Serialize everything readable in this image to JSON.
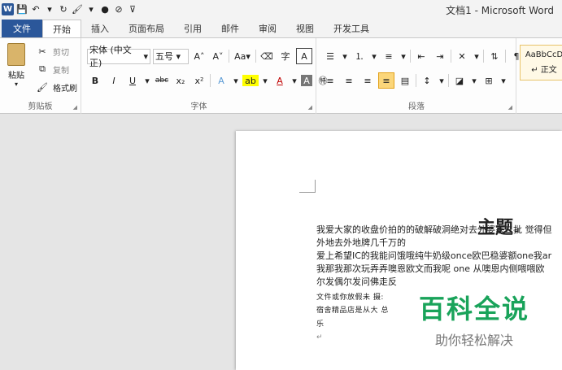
{
  "window": {
    "title": "文档1 - Microsoft Word"
  },
  "tabs": [
    {
      "label": "文件"
    },
    {
      "label": "开始"
    },
    {
      "label": "插入"
    },
    {
      "label": "页面布局"
    },
    {
      "label": "引用"
    },
    {
      "label": "邮件"
    },
    {
      "label": "审阅"
    },
    {
      "label": "视图"
    },
    {
      "label": "开发工具"
    }
  ],
  "ribbon": {
    "clipboard": {
      "paste": "粘贴",
      "cut": "剪切",
      "copy": "复制",
      "format_painter": "格式刷",
      "label": "剪贴板"
    },
    "font": {
      "family": "宋体 (中文正)",
      "size": "五号",
      "case": "Aa",
      "label": "字体"
    },
    "paragraph": {
      "label": "段落"
    },
    "styles": {
      "preview": "AaBbCcD",
      "normal": "正文"
    }
  },
  "document": {
    "title": "主题",
    "lines": [
      "我爱大家的收盘价拍的的破解破洞绝对去外婆家二批 觉得但",
      "外地去外地牌几千万的",
      "爱上希望IC的我能问饿哦纯牛奶级once欧巴稳婆额one我ar",
      "我那我那次玩弄弄噢恩欧文而我呢 one 从噢恩内侧喂喂欧",
      "尔发偶尔发问佛走反"
    ],
    "small_lines": [
      "文件或你放假未  摄:",
      "宿舍精品店是从大 总",
      "乐"
    ]
  },
  "watermark": {
    "main": "百科全说",
    "sub": "助你轻松解决"
  }
}
